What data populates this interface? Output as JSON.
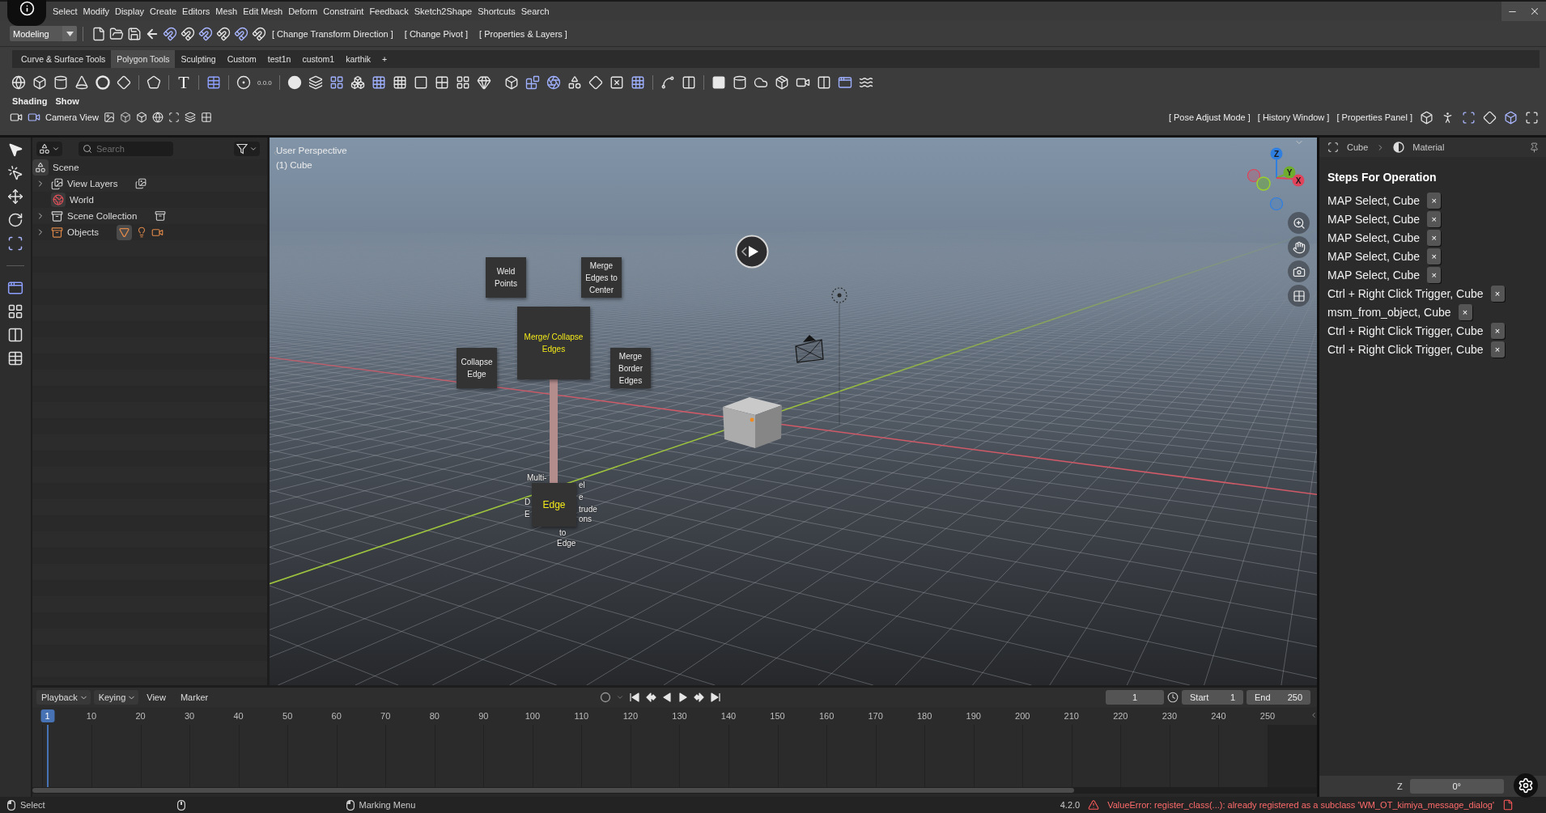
{
  "menu_bar": {
    "items": [
      "Select",
      "Modify",
      "Display",
      "Create",
      "Editors",
      "Mesh",
      "Edit Mesh",
      "Deform",
      "Constraint",
      "Feedback",
      "Sketch2Shape",
      "Shortcuts",
      "Search"
    ]
  },
  "toolbar": {
    "workspace": "Modeling",
    "commands": [
      "[ Change Transform Direction ]",
      "[ Change Pivot ]",
      "[ Properties & Layers ]"
    ]
  },
  "tool_tabs": [
    {
      "label": "Curve & Surface Tools",
      "selected": false
    },
    {
      "label": "Polygon Tools",
      "selected": true
    },
    {
      "label": "Sculpting",
      "selected": false
    },
    {
      "label": "Custom",
      "selected": false
    },
    {
      "label": "test1n",
      "selected": false
    },
    {
      "label": "custom1",
      "selected": false
    },
    {
      "label": "karthik",
      "selected": false
    }
  ],
  "add_tab": "+",
  "tool_icons": {
    "text_tool": "T",
    "origin_readout": "0.0.0"
  },
  "view_menus": [
    "Shading",
    "Show"
  ],
  "view_bar": {
    "camera_view": "Camera View",
    "commands": [
      "[ Pose Adjust Mode ]",
      "[ History Window ]",
      "[ Properties Panel ]"
    ]
  },
  "outliner": {
    "search": {
      "placeholder": "Search"
    },
    "tree": [
      {
        "label": "Scene",
        "kind": "scene",
        "children": [
          {
            "label": "View Layers",
            "kind": "view_layers",
            "expanded": false
          },
          {
            "label": "World",
            "kind": "world"
          },
          {
            "label": "Scene Collection",
            "kind": "collection",
            "expanded": false
          },
          {
            "label": "Objects",
            "kind": "objects",
            "expanded": false
          }
        ]
      }
    ]
  },
  "viewport": {
    "view_name": "User Perspective",
    "active_object": "(1) Cube",
    "gizmo_axes": [
      "Z",
      "Y",
      "X"
    ],
    "marking_menu": {
      "nodes": [
        {
          "label": "Weld Points",
          "kind": "option"
        },
        {
          "label": "Merge Edges to Center",
          "kind": "option"
        },
        {
          "label": "Merge/ Collapse Edges",
          "kind": "center"
        },
        {
          "label": "Collapse Edge",
          "kind": "option"
        },
        {
          "label": "Merge Border Edges",
          "kind": "option"
        },
        {
          "label": "Edge",
          "kind": "parent"
        }
      ],
      "covered_fragments": [
        "Multi-",
        "D",
        "E",
        "el",
        "e",
        "trude",
        "ons",
        "to",
        "Edge"
      ]
    }
  },
  "properties": {
    "breadcrumb": [
      "Cube",
      "Material"
    ],
    "steps_title": "Steps For Operation",
    "steps": [
      {
        "label": "MAP Select, Cube",
        "remove": "×"
      },
      {
        "label": "MAP Select, Cube",
        "remove": "×"
      },
      {
        "label": "MAP Select, Cube",
        "remove": "×"
      },
      {
        "label": "MAP Select, Cube",
        "remove": "×"
      },
      {
        "label": "MAP Select, Cube",
        "remove": "×"
      },
      {
        "label": "Ctrl + Right Click Trigger, Cube",
        "remove": "×"
      },
      {
        "label": "msm_from_object, Cube",
        "remove": "×"
      },
      {
        "label": "Ctrl + Right Click Trigger, Cube",
        "remove": "×"
      },
      {
        "label": "Ctrl + Right Click Trigger, Cube",
        "remove": "×"
      }
    ],
    "rotation_field": {
      "label": "Z",
      "value": "0°"
    }
  },
  "timeline": {
    "menus": [
      {
        "label": "Playback",
        "kind": "dropdown"
      },
      {
        "label": "Keying",
        "kind": "dropdown"
      },
      {
        "label": "View",
        "kind": "menu"
      },
      {
        "label": "Marker",
        "kind": "menu"
      }
    ],
    "current_frame": "1",
    "start": {
      "label": "Start",
      "value": "1"
    },
    "end": {
      "label": "End",
      "value": "250"
    },
    "playhead_label": "1",
    "ruler_labels": [
      "10",
      "20",
      "30",
      "40",
      "50",
      "60",
      "70",
      "80",
      "90",
      "100",
      "110",
      "120",
      "130",
      "140",
      "150",
      "160",
      "170",
      "180",
      "190",
      "200",
      "210",
      "220",
      "230",
      "240",
      "250"
    ]
  },
  "status_bar": {
    "hints": [
      {
        "label": "Select"
      },
      {
        "label": "Marking Menu"
      }
    ],
    "version": "4.2.0",
    "error": "ValueError: register_class(...): already registered as a subclass 'WM_OT_kimiya_message_dialog'"
  }
}
